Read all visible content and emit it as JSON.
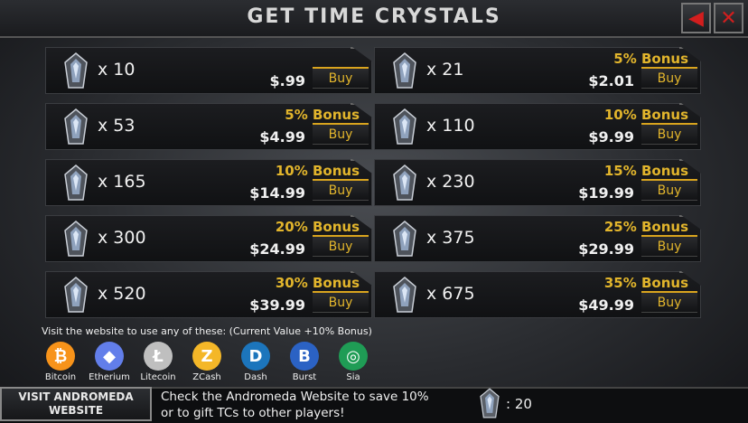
{
  "header": {
    "title": "GET TIME CRYSTALS",
    "back_icon": "arrow-left-icon",
    "close_icon": "close-icon"
  },
  "packs": [
    {
      "qty": "x 10",
      "bonus": "",
      "price": "$.99",
      "buy": "Buy"
    },
    {
      "qty": "x 21",
      "bonus": "5% Bonus",
      "price": "$2.01",
      "buy": "Buy"
    },
    {
      "qty": "x 53",
      "bonus": "5% Bonus",
      "price": "$4.99",
      "buy": "Buy"
    },
    {
      "qty": "x 110",
      "bonus": "10% Bonus",
      "price": "$9.99",
      "buy": "Buy"
    },
    {
      "qty": "x 165",
      "bonus": "10% Bonus",
      "price": "$14.99",
      "buy": "Buy"
    },
    {
      "qty": "x 230",
      "bonus": "15% Bonus",
      "price": "$19.99",
      "buy": "Buy"
    },
    {
      "qty": "x 300",
      "bonus": "20% Bonus",
      "price": "$24.99",
      "buy": "Buy"
    },
    {
      "qty": "x 375",
      "bonus": "25% Bonus",
      "price": "$29.99",
      "buy": "Buy"
    },
    {
      "qty": "x 520",
      "bonus": "30% Bonus",
      "price": "$39.99",
      "buy": "Buy"
    },
    {
      "qty": "x 675",
      "bonus": "35% Bonus",
      "price": "$49.99",
      "buy": "Buy"
    }
  ],
  "crypto": {
    "intro": "Visit the website to use any of these: (Current Value +10% Bonus)",
    "coins": [
      {
        "name": "Bitcoin",
        "glyph": "₿",
        "color": "#f7931a"
      },
      {
        "name": "Etherium",
        "glyph": "◆",
        "color": "#627eea"
      },
      {
        "name": "Litecoin",
        "glyph": "Ł",
        "color": "#bfbfbf"
      },
      {
        "name": "ZCash",
        "glyph": "Z",
        "color": "#f4b728"
      },
      {
        "name": "Dash",
        "glyph": "D",
        "color": "#1c75bc"
      },
      {
        "name": "Burst",
        "glyph": "B",
        "color": "#2b62c4"
      },
      {
        "name": "Sia",
        "glyph": "◎",
        "color": "#1f9c55"
      }
    ]
  },
  "footer": {
    "visit_line1": "VISIT ANDROMEDA",
    "visit_line2": "WEBSITE",
    "msg_line1": "Check the Andromeda Website to save 10%",
    "msg_line2": "or to gift TCs to other players!",
    "tc_count": ": 20"
  },
  "colors": {
    "accent_gold": "#e2b52c",
    "danger_red": "#d21e1e"
  }
}
